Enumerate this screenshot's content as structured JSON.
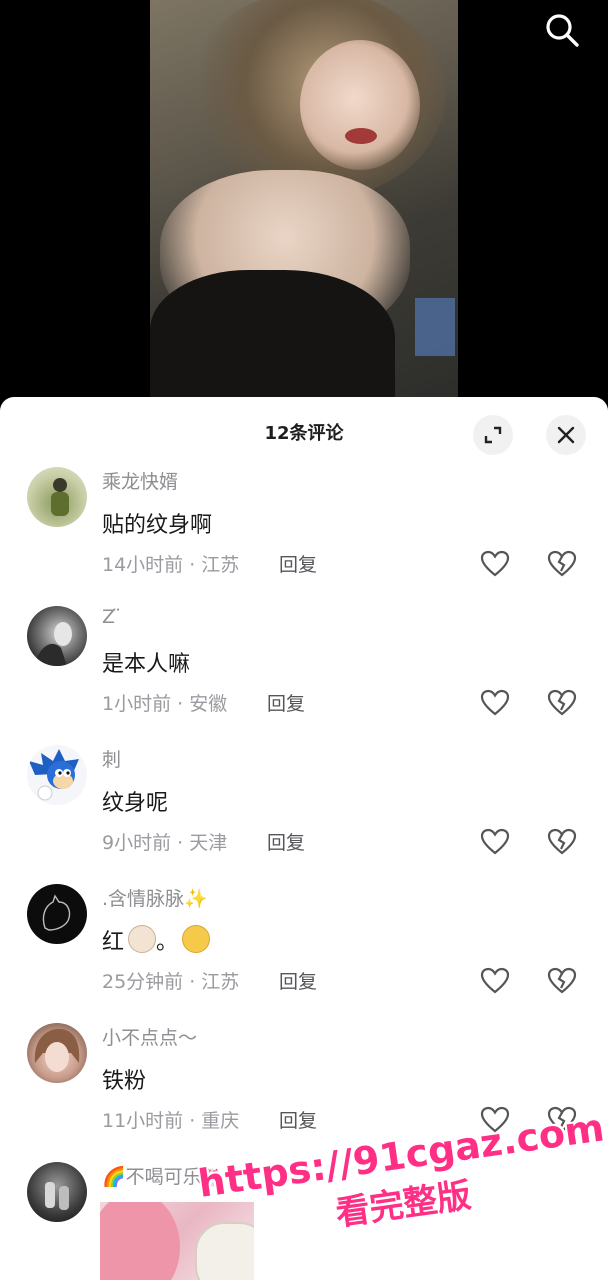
{
  "header": {
    "comment_count_title": "12条评论"
  },
  "comments": [
    {
      "username": "乘龙快婿",
      "text": "贴的纹身啊",
      "meta": "14小时前 · 江苏",
      "reply": "回复"
    },
    {
      "username": "Z ̈",
      "text": "是本人嘛",
      "meta": "1小时前 · 安徽",
      "reply": "回复"
    },
    {
      "username": "刺",
      "text": "纹身呢",
      "meta": "9小时前 · 天津",
      "reply": "回复"
    },
    {
      "username": ".含情脉脉✨",
      "text": "红",
      "text_suffix": "。",
      "meta": "25分钟前 · 江苏",
      "reply": "回复"
    },
    {
      "username": "小不点点～",
      "text": "铁粉",
      "meta": "11小时前 · 重庆",
      "reply": "回复"
    },
    {
      "username": "🌈不喝可乐🦄"
    }
  ],
  "watermark": {
    "url": "https://91cgaz.com",
    "subtitle": "看完整版"
  },
  "icons": {
    "search": "search-icon",
    "expand": "expand-icon",
    "close": "close-icon",
    "like": "heart-icon",
    "dislike": "broken-heart-icon"
  }
}
